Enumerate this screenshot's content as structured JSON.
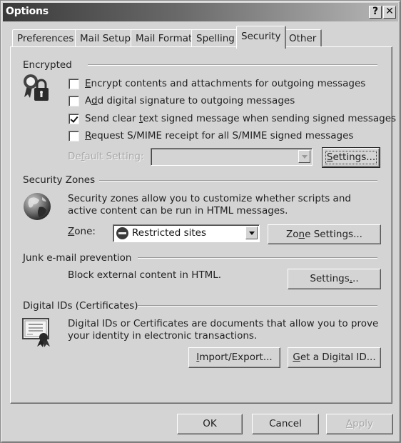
{
  "window": {
    "title": "Options",
    "help_button": "?",
    "close_button": "✕"
  },
  "tabs": [
    {
      "label": "Preferences",
      "active": false
    },
    {
      "label": "Mail Setup",
      "active": false
    },
    {
      "label": "Mail Format",
      "active": false
    },
    {
      "label": "Spelling",
      "active": false
    },
    {
      "label": "Security",
      "active": true
    },
    {
      "label": "Other",
      "active": false
    }
  ],
  "encrypted": {
    "heading": "Encrypted",
    "icon": "certificate-lock-icon",
    "checkboxes": [
      {
        "pre": "",
        "mnemonic": "E",
        "post": "ncrypt contents and attachments for outgoing messages",
        "checked": false
      },
      {
        "pre": "A",
        "mnemonic": "d",
        "post": "d digital signature to outgoing messages",
        "checked": false
      },
      {
        "pre": "Send clear ",
        "mnemonic": "t",
        "post": "ext signed message when sending signed messages",
        "checked": true
      },
      {
        "pre": "",
        "mnemonic": "R",
        "post": "equest S/MIME receipt for all S/MIME signed messages",
        "checked": false
      }
    ],
    "default_setting": {
      "pre": "De",
      "mnemonic": "f",
      "post": "ault Setting:",
      "value": "",
      "disabled": true
    },
    "settings_button": {
      "pre": "",
      "mnemonic": "S",
      "post": "ettings..."
    }
  },
  "security_zones": {
    "heading": "Security Zones",
    "icon": "globe-icon",
    "description": "Security zones allow you to customize whether scripts and active content can be run in HTML messages.",
    "zone_label": {
      "pre": "",
      "mnemonic": "Z",
      "post": "one:"
    },
    "zone_value": "Restricted sites",
    "zone_value_icon": "restricted-icon",
    "zone_settings_button": {
      "pre": "Zo",
      "mnemonic": "n",
      "post": "e Settings..."
    }
  },
  "junk": {
    "heading": "Junk e-mail prevention",
    "description": "Block external content in HTML.",
    "settings_button": {
      "pre": "Settings",
      "mnemonic": ".",
      "post": ".."
    }
  },
  "digital_ids": {
    "heading": "Digital IDs (Certificates)",
    "icon": "certificate-icon",
    "description": "Digital IDs or Certificates are documents that allow you to prove your identity in electronic transactions.",
    "import_export_button": {
      "pre": "",
      "mnemonic": "I",
      "post": "mport/Export..."
    },
    "get_id_button": {
      "pre": "",
      "mnemonic": "G",
      "post": "et a Digital ID..."
    }
  },
  "footer": {
    "ok": "OK",
    "cancel": "Cancel",
    "apply": {
      "pre": "",
      "mnemonic": "A",
      "post": "pply",
      "disabled": true
    }
  }
}
